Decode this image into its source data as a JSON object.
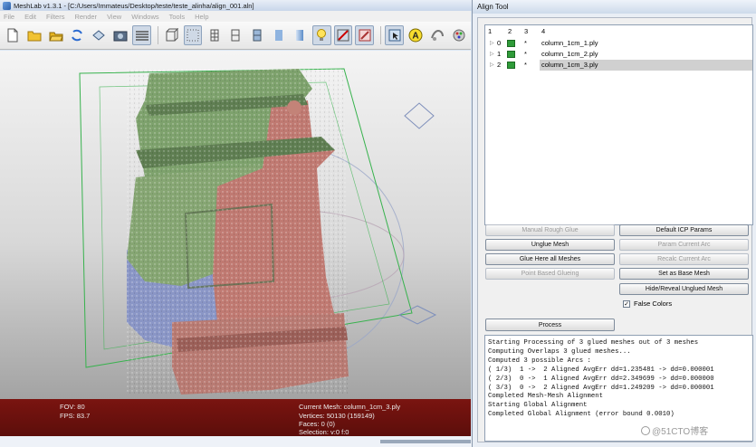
{
  "window": {
    "title": "MeshLab v1.3.1 - [C:/Users/Immateus/Desktop/teste/teste_alinha/align_001.aln]"
  },
  "menu": [
    "File",
    "Edit",
    "Filters",
    "Render",
    "View",
    "Windows",
    "Tools",
    "Help"
  ],
  "toolbar": {
    "buttons": [
      "new-project",
      "open-mesh",
      "open-folder",
      "reload",
      "save",
      "snapshot",
      "layers",
      "bounding-box",
      "points",
      "wireframe",
      "hidden-lines",
      "flat-lines",
      "flat",
      "smooth",
      "lighting",
      "double-side",
      "edit",
      "annotate",
      "align",
      "color"
    ]
  },
  "status": {
    "fov": "FOV: 80",
    "fps": "FPS:   83.7",
    "current_mesh": "Current Mesh: column_1cm_3.ply",
    "vertices": "Vertices: 50130 (159149)",
    "faces": "Faces: 0 (0)",
    "selection": "Selection: v:0 f:0"
  },
  "align_tool": {
    "title": "Align Tool",
    "columns": [
      "1",
      "2",
      "3",
      "4"
    ],
    "rows": [
      {
        "id": "0",
        "star": "*",
        "name": "column_1cm_1.ply"
      },
      {
        "id": "1",
        "star": "*",
        "name": "column_1cm_2.ply"
      },
      {
        "id": "2",
        "star": "*",
        "name": "column_1cm_3.ply"
      }
    ],
    "buttons": {
      "manual_rough_glue": "Manual Rough Glue",
      "default_icp": "Default ICP Params",
      "unglue_mesh": "Unglue Mesh",
      "param_current_arc": "Param Current Arc",
      "glue_here_all": "Glue Here all Meshes",
      "recalc_current_arc": "Recalc Current Arc",
      "point_based_glueing": "Point Based Glueing",
      "set_as_base_mesh": "Set as Base Mesh",
      "hide_reveal": "Hide/Reveal Unglued Mesh",
      "process": "Process"
    },
    "false_colors_label": "False Colors",
    "false_colors_checked": true,
    "log": [
      "Starting Processing of 3 glued meshes out of 3 meshes",
      "Computing Overlaps 3 glued meshes...",
      "Computed 3 possible Arcs :",
      "( 1/3)  1 ->  2 Aligned AvgErr dd=1.235481 -> dd=0.000001",
      "( 2/3)  0 ->  1 Aligned AvgErr dd=2.349699 -> dd=0.000000",
      "( 3/3)  0 ->  2 Aligned AvgErr dd=1.249209 -> dd=0.000001",
      "Completed Mesh-Mesh Alignment",
      "Starting Global Alignment",
      "Completed Global Alignment (error bound 0.0010)"
    ]
  },
  "watermark": "@51CTO博客",
  "colors": {
    "status_bg": "#6b110d",
    "mesh_green": "#7ea26d",
    "mesh_red": "#c07a72",
    "mesh_blue": "#8a96c6",
    "vis_icon": "#2f9b39"
  }
}
